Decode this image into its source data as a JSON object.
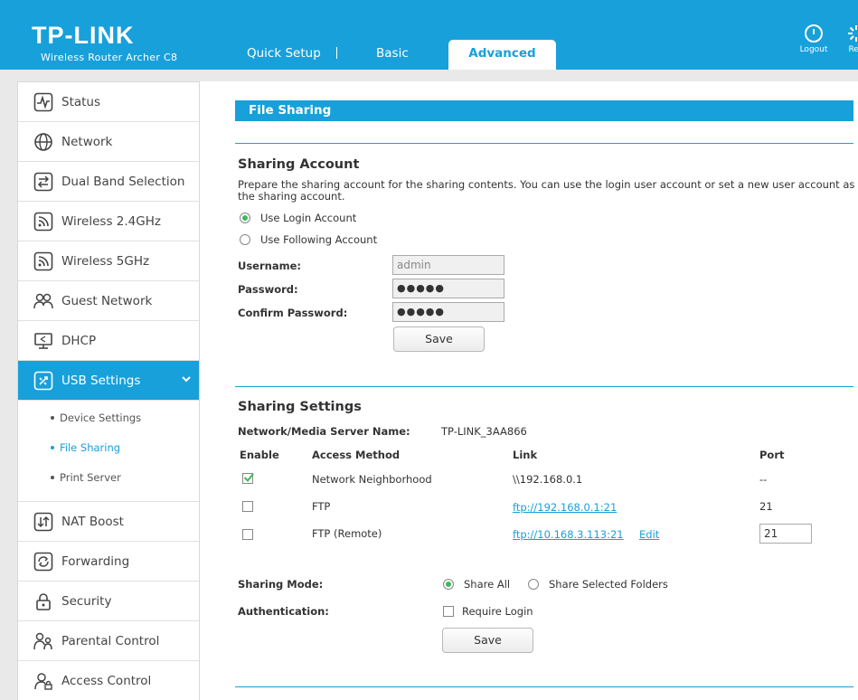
{
  "header": {
    "logo": "TP-LINK",
    "model": "Wireless Router Archer C8",
    "tabs": [
      {
        "label": "Quick Setup"
      },
      {
        "label": "Basic"
      },
      {
        "label": "Advanced"
      }
    ],
    "logout_label": "Logout",
    "reboot_label": "Reb"
  },
  "sidebar": {
    "items": [
      {
        "label": "Status",
        "icon": "status-icon"
      },
      {
        "label": "Network",
        "icon": "globe-icon"
      },
      {
        "label": "Dual Band Selection",
        "icon": "dual-band-icon"
      },
      {
        "label": "Wireless 2.4GHz",
        "icon": "wireless-icon"
      },
      {
        "label": "Wireless 5GHz",
        "icon": "wireless-icon"
      },
      {
        "label": "Guest Network",
        "icon": "guest-icon"
      },
      {
        "label": "DHCP",
        "icon": "dhcp-icon"
      },
      {
        "label": "USB Settings",
        "icon": "usb-icon"
      },
      {
        "label": "NAT Boost",
        "icon": "nat-boost-icon"
      },
      {
        "label": "Forwarding",
        "icon": "forwarding-icon"
      },
      {
        "label": "Security",
        "icon": "lock-icon"
      },
      {
        "label": "Parental Control",
        "icon": "parental-icon"
      },
      {
        "label": "Access Control",
        "icon": "access-control-icon"
      }
    ],
    "usb_subitems": [
      {
        "label": "Device Settings"
      },
      {
        "label": "File Sharing"
      },
      {
        "label": "Print Server"
      }
    ]
  },
  "main": {
    "section_title": "File Sharing",
    "account": {
      "title": "Sharing Account",
      "description": "Prepare the sharing account for the sharing contents. You can use the login user account or set a new user account as the sharing account.",
      "option_login": "Use Login Account",
      "option_following": "Use Following Account",
      "username_label": "Username:",
      "username_value": "admin",
      "password_label": "Password:",
      "password_value": "●●●●●",
      "confirm_label": "Confirm Password:",
      "confirm_value": "●●●●●",
      "save_label": "Save"
    },
    "settings": {
      "title": "Sharing Settings",
      "server_name_label": "Network/Media Server Name:",
      "server_name_value": "TP-LINK_3AA866",
      "columns": {
        "enable": "Enable",
        "method": "Access Method",
        "link": "Link",
        "port": "Port"
      },
      "rows": [
        {
          "enabled": true,
          "method": "Network Neighborhood",
          "link": "\\\\192.168.0.1",
          "port": "--"
        },
        {
          "enabled": false,
          "method": "FTP",
          "link": "ftp://192.168.0.1:21",
          "port": "21"
        },
        {
          "enabled": false,
          "method": "FTP (Remote)",
          "link": "ftp://10.168.3.113:21",
          "edit": "Edit",
          "port": "21"
        }
      ],
      "mode_label": "Sharing Mode:",
      "mode_all": "Share All",
      "mode_selected": "Share Selected Folders",
      "auth_label": "Authentication:",
      "auth_option": "Require Login",
      "save_label": "Save"
    }
  },
  "colors": {
    "accent": "#18a0da",
    "radio_on": "#3cb95c",
    "check": "#3cb95c"
  }
}
